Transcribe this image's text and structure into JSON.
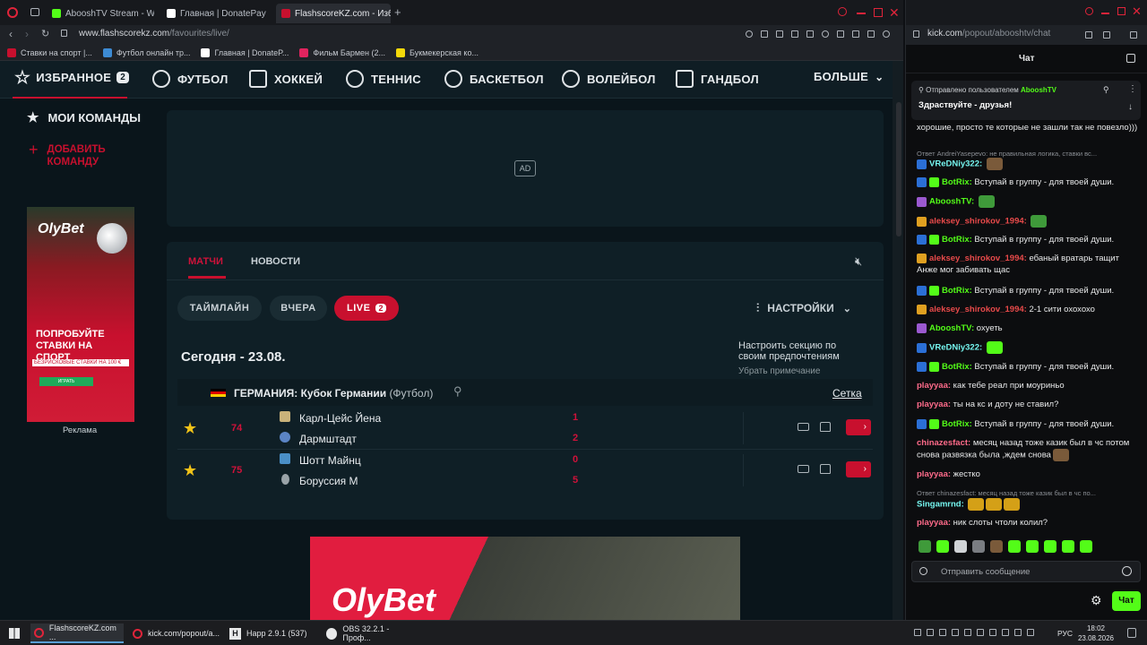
{
  "left_browser": {
    "tabs": [
      {
        "label": "AbooshTV Stream - Watch",
        "favicon_color": "#53fc18",
        "active": false
      },
      {
        "label": "Главная | DonatePay",
        "favicon_color": "#ffffff",
        "active": false
      },
      {
        "label": "FlashscoreKZ.com - Избра",
        "favicon_color": "#c8102e",
        "active": true
      }
    ],
    "url_host": "www.flashscorekz.com",
    "url_path": "/favourites/live/",
    "bookmarks": [
      {
        "label": "Ставки на спорт |...",
        "color": "#c8102e"
      },
      {
        "label": "Футбол онлайн тр...",
        "color": "#3d8bd4"
      },
      {
        "label": "Главная | DonateP...",
        "color": "#ffffff"
      },
      {
        "label": "Фильм Бармен (2...",
        "color": "#e0245e"
      },
      {
        "label": "Букмекерская ко...",
        "color": "#f5d90a"
      }
    ]
  },
  "site": {
    "nav": [
      {
        "label": "ИЗБРАННОЕ",
        "icon": "star-icon",
        "badge": "2"
      },
      {
        "label": "ФУТБОЛ",
        "icon": "football-icon"
      },
      {
        "label": "ХОККЕЙ",
        "icon": "hockey-icon"
      },
      {
        "label": "ТЕННИС",
        "icon": "tennis-icon"
      },
      {
        "label": "БАСКЕТБОЛ",
        "icon": "basketball-icon"
      },
      {
        "label": "ВОЛЕЙБОЛ",
        "icon": "volleyball-icon"
      },
      {
        "label": "ГАНДБОЛ",
        "icon": "handball-icon"
      }
    ],
    "nav_more": "БОЛЬШЕ",
    "my_teams": "МОИ КОМАНДЫ",
    "add_team": "ДОБАВИТЬ КОМАНДУ",
    "side_ad": {
      "brand": "OlyBet",
      "headline": "ПОПРОБУЙТЕ СТАВКИ НА СПОРТ",
      "subline": "БЕЗРИСКОВЫЕ СТАВКИ НА 100 €",
      "button": "ИГРАТЬ",
      "caption": "Реклама"
    },
    "ad_placeholder": "AD",
    "tabs": [
      "МАТЧИ",
      "НОВОСТИ"
    ],
    "filters": [
      "ТАЙМЛАЙН",
      "ВЧЕРА",
      "LIVE"
    ],
    "live_count": "2",
    "settings": "НАСТРОЙКИ",
    "tooltip": {
      "text": "Настроить секцию по своим предпочтениям",
      "dismiss": "Убрать примечание"
    },
    "date_heading": "Сегодня - 23.08.",
    "league": {
      "country": "ГЕРМАНИЯ:",
      "name": "Кубок Германии",
      "sport": "(Футбол)",
      "link": "Сетка"
    },
    "matches": [
      {
        "minute": "74",
        "home": "Карл-Цейс Йена",
        "away": "Дармштадт",
        "home_score": "1",
        "away_score": "2"
      },
      {
        "minute": "75",
        "home": "Шотт Майнц",
        "away": "Боруссия М",
        "home_score": "0",
        "away_score": "5"
      }
    ],
    "bottom_ad_brand": "OlyBet"
  },
  "right_browser": {
    "url_host": "kick.com",
    "url_path": "/popout/abooshtv/chat",
    "header": "Чат",
    "pinned": {
      "by_prefix": "Отправлено пользователем",
      "by_user": "AbooshTV",
      "text": "Здраствуйте - друзья!"
    },
    "messages": [
      {
        "kind": "text",
        "user": "",
        "color": "#e8e9ea",
        "text": "хорошие, просто те которые не зашли так не повезло)))",
        "badges": []
      },
      {
        "kind": "reply",
        "text": "Ответ AndreiYasepevo: не правильная логика, ставки вс..."
      },
      {
        "kind": "text",
        "user": "VReDNiy322:",
        "color": "#75f5ef",
        "text": "",
        "badges": [
          "#2b6fd6"
        ],
        "emotes": [
          "#7a5a3a"
        ]
      },
      {
        "kind": "text",
        "user": "BotRix:",
        "color": "#53fc18",
        "text": "Вступай в группу - для твоей души.",
        "badges": [
          "#2b6fd6",
          "#53fc18"
        ]
      },
      {
        "kind": "text",
        "user": "AbooshTV:",
        "color": "#53fc18",
        "text": "",
        "badges": [
          "#9b59d0"
        ],
        "emotes": [
          "#3f9a3a"
        ]
      },
      {
        "kind": "text",
        "user": "aleksey_shirokov_1994:",
        "color": "#e84a4a",
        "text": "",
        "badges": [
          "#e0a020"
        ],
        "emotes": [
          "#3f9a3a"
        ]
      },
      {
        "kind": "text",
        "user": "BotRix:",
        "color": "#53fc18",
        "text": "Вступай в группу - для твоей души.",
        "badges": [
          "#2b6fd6",
          "#53fc18"
        ]
      },
      {
        "kind": "text",
        "user": "aleksey_shirokov_1994:",
        "color": "#e84a4a",
        "text": "ебаный вратарь тащит Анже мог забивать щас",
        "badges": [
          "#e0a020"
        ]
      },
      {
        "kind": "text",
        "user": "BotRix:",
        "color": "#53fc18",
        "text": "Вступай в группу - для твоей души.",
        "badges": [
          "#2b6fd6",
          "#53fc18"
        ]
      },
      {
        "kind": "text",
        "user": "aleksey_shirokov_1994:",
        "color": "#e84a4a",
        "text": "2-1 сити охохохо",
        "badges": [
          "#e0a020"
        ]
      },
      {
        "kind": "text",
        "user": "AbooshTV:",
        "color": "#53fc18",
        "text": "охуеть",
        "badges": [
          "#9b59d0"
        ]
      },
      {
        "kind": "text",
        "user": "VReDNiy322:",
        "color": "#75f5ef",
        "text": "",
        "badges": [
          "#2b6fd6"
        ],
        "emotes": [
          "#53fc18"
        ]
      },
      {
        "kind": "text",
        "user": "BotRix:",
        "color": "#53fc18",
        "text": "Вступай в группу - для твоей души.",
        "badges": [
          "#2b6fd6",
          "#53fc18"
        ]
      },
      {
        "kind": "text",
        "user": "playyaa:",
        "color": "#ff6b8a",
        "text": "как тебе реал при моуриньо",
        "badges": []
      },
      {
        "kind": "text",
        "user": "playyaa:",
        "color": "#ff6b8a",
        "text": "ты на кс и доту не ставил?",
        "badges": []
      },
      {
        "kind": "text",
        "user": "BotRix:",
        "color": "#53fc18",
        "text": "Вступай в группу - для твоей души.",
        "badges": [
          "#2b6fd6",
          "#53fc18"
        ]
      },
      {
        "kind": "text",
        "user": "chinazesfact:",
        "color": "#ff6b8a",
        "text": "месяц назад тоже казик был в чс потом снова развязка была ,ждем снова",
        "badges": [],
        "emotes": [
          "#7a5a3a"
        ]
      },
      {
        "kind": "text",
        "user": "playyaa:",
        "color": "#ff6b8a",
        "text": "жестко",
        "badges": []
      },
      {
        "kind": "reply",
        "text": "Ответ chinazesfact: месяц назад тоже казик был в чс по..."
      },
      {
        "kind": "text",
        "user": "Singamrnd:",
        "color": "#75f5ef",
        "text": "",
        "badges": [],
        "emotes": [
          "#d4a017",
          "#d4a017",
          "#d4a017"
        ]
      },
      {
        "kind": "text",
        "user": "playyaa:",
        "color": "#ff6b8a",
        "text": "ник слоты чтоли колил?",
        "badges": []
      }
    ],
    "input_placeholder": "Отправить сообщение",
    "send_button": "Чат"
  },
  "taskbar": {
    "items": [
      "FlashscoreKZ.com ...",
      "kick.com/popout/a...",
      "Happ 2.9.1 (537)",
      "OBS 32.2.1 - Проф..."
    ],
    "lang": "РУС",
    "time": "18:02",
    "date": "23.08.2026"
  }
}
